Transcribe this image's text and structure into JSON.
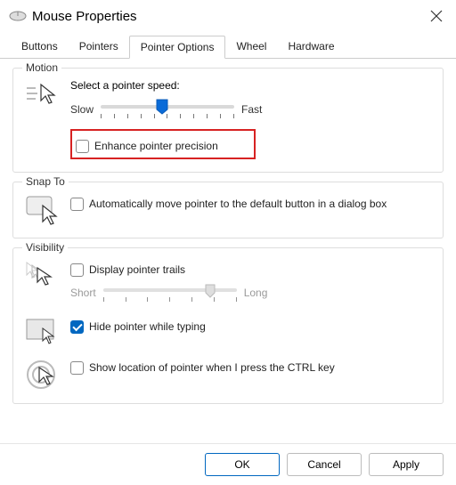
{
  "window": {
    "title": "Mouse Properties"
  },
  "tabs": [
    "Buttons",
    "Pointers",
    "Pointer Options",
    "Wheel",
    "Hardware"
  ],
  "activeTab": 2,
  "motion": {
    "group": "Motion",
    "selectLabel": "Select a pointer speed:",
    "slow": "Slow",
    "fast": "Fast",
    "sliderPos": 46,
    "enhance": {
      "label": "Enhance pointer precision",
      "checked": false
    }
  },
  "snap": {
    "group": "Snap To",
    "auto": {
      "label": "Automatically move pointer to the default button in a dialog box",
      "checked": false
    }
  },
  "visibility": {
    "group": "Visibility",
    "trails": {
      "label": "Display pointer trails",
      "checked": false
    },
    "short": "Short",
    "long": "Long",
    "trailPos": 80,
    "hide": {
      "label": "Hide pointer while typing",
      "checked": true
    },
    "ctrl": {
      "label": "Show location of pointer when I press the CTRL key",
      "checked": false
    }
  },
  "buttons": {
    "ok": "OK",
    "cancel": "Cancel",
    "apply": "Apply"
  }
}
